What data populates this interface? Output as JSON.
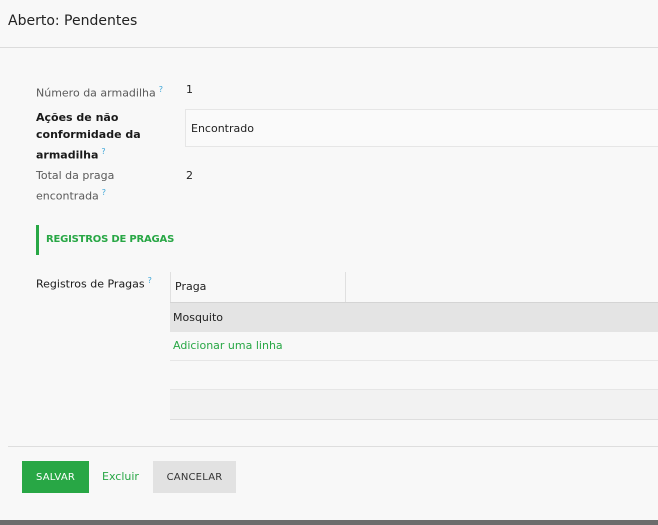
{
  "header": {
    "title": "Aberto: Pendentes"
  },
  "form": {
    "help_mark": "?",
    "fields": {
      "trap_number": {
        "label": "Número da armadilha",
        "value": "1"
      },
      "nonconformity_actions": {
        "label_lines": [
          "Ações de não",
          "conformidade da",
          "armadilha"
        ],
        "value": "Encontrado"
      },
      "total_pests": {
        "label_lines": [
          "Total da praga",
          "encontrada"
        ],
        "value": "2"
      }
    },
    "section": {
      "title": "REGISTROS DE PRAGAS"
    },
    "pest_records": {
      "label": "Registros de Pragas",
      "columns": [
        "Praga"
      ],
      "rows": [
        [
          "Mosquito"
        ]
      ],
      "add_line": "Adicionar uma linha"
    }
  },
  "footer": {
    "save_label": "SALVAR",
    "discard_label": "Excluir",
    "cancel_label": "CANCELAR"
  },
  "colors": {
    "accent": "#28a745",
    "help": "#3ea6d8",
    "row_highlight": "#e4e4e4"
  }
}
